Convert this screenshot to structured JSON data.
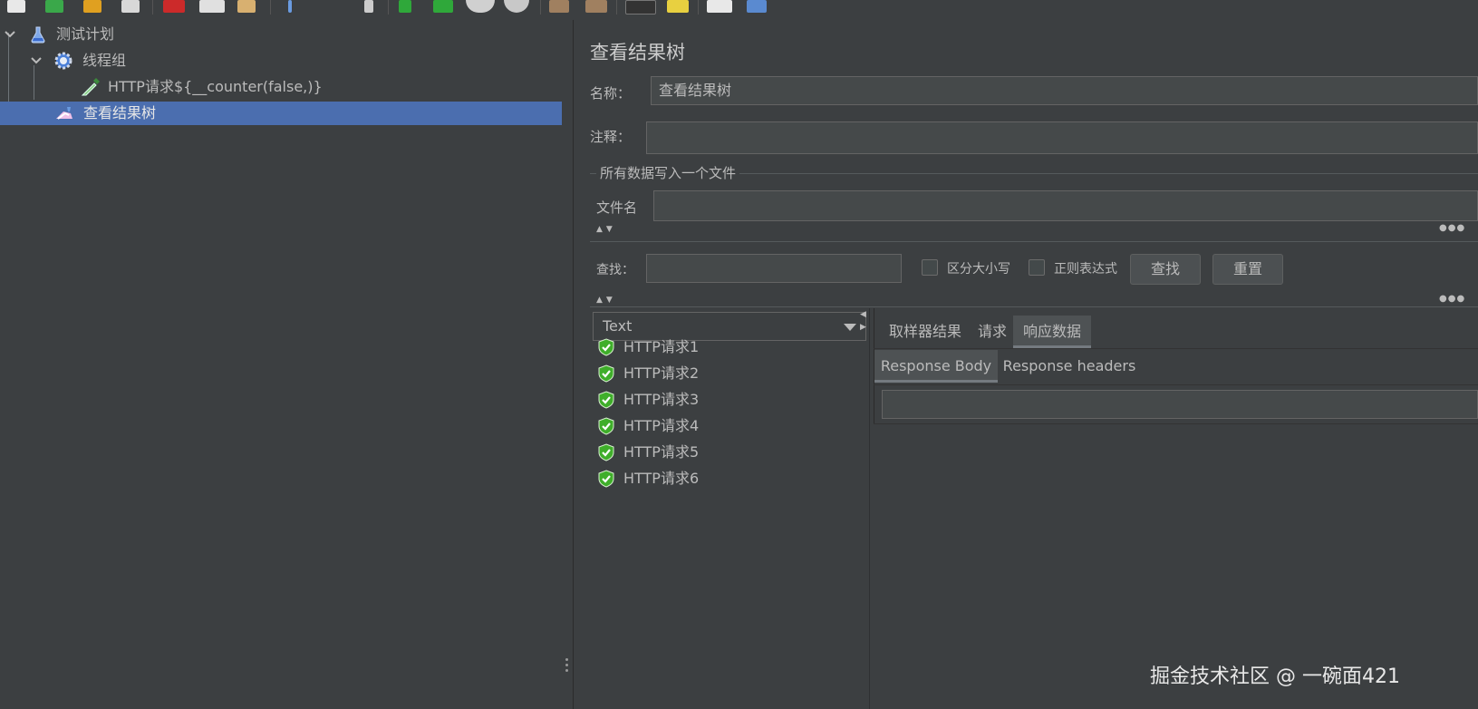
{
  "tree": {
    "items": [
      {
        "label": "测试计划",
        "icon": "test-plan-icon"
      },
      {
        "label": "线程组",
        "icon": "gear-icon"
      },
      {
        "label": "HTTP请求${__counter(false,)}",
        "icon": "sampler-pipette-icon"
      },
      {
        "label": "查看结果树",
        "icon": "result-tree-icon"
      }
    ]
  },
  "panel": {
    "title": "查看结果树",
    "name_label": "名称：",
    "name_value": "查看结果树",
    "comment_label": "注释：",
    "comment_value": "",
    "file_group_label": "所有数据写入一个文件",
    "file_label": "文件名",
    "file_value": ""
  },
  "search": {
    "label": "查找：",
    "value": "",
    "case_label": "区分大小写",
    "case_checked": false,
    "regex_label": "正则表达式",
    "regex_checked": false,
    "find_button": "查找",
    "reset_button": "重置"
  },
  "renderer": {
    "selected": "Text"
  },
  "results": [
    {
      "label": "HTTP请求1",
      "status": "success"
    },
    {
      "label": "HTTP请求2",
      "status": "success"
    },
    {
      "label": "HTTP请求3",
      "status": "success"
    },
    {
      "label": "HTTP请求4",
      "status": "success"
    },
    {
      "label": "HTTP请求5",
      "status": "success"
    },
    {
      "label": "HTTP请求6",
      "status": "success"
    }
  ],
  "tabs": {
    "main": [
      "取样器结果",
      "请求",
      "响应数据"
    ],
    "main_active": 2,
    "sub": [
      "Response Body",
      "Response headers"
    ],
    "sub_active": 0
  },
  "watermark": "掘金技术社区 @ 一碗面421",
  "colors": {
    "background": "#3c3f41",
    "selection": "#4b6eaf",
    "field": "#45494a",
    "success_green": "#3fae2a"
  }
}
